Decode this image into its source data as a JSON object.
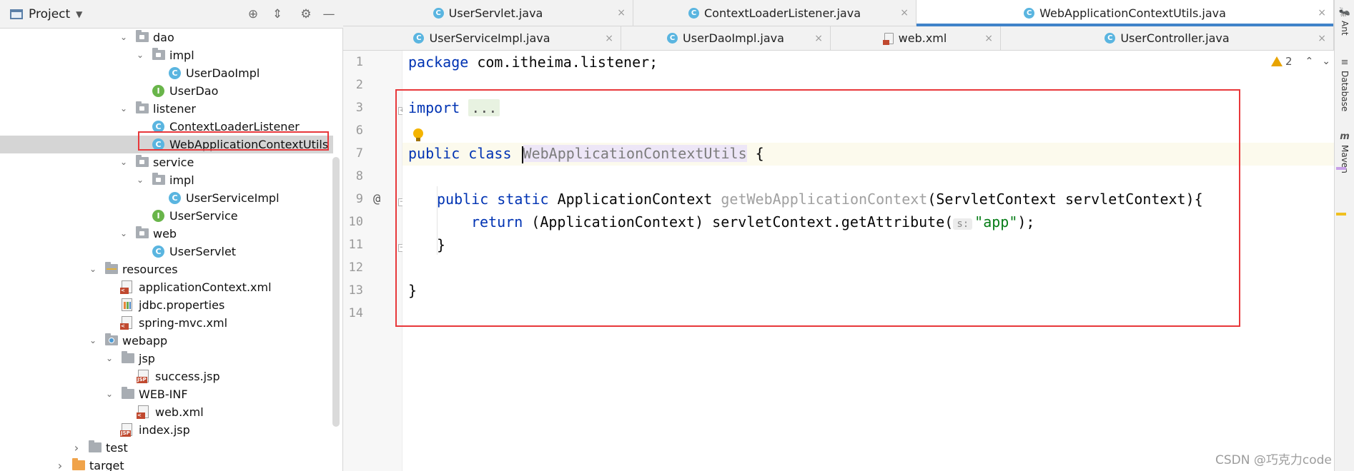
{
  "project_panel": {
    "title": "Project",
    "caret": "▼",
    "buttons": {
      "locate": "⊕",
      "collapse": "⇕",
      "settings": "⚙",
      "hide": "—"
    },
    "tree": [
      {
        "label": "dao",
        "type": "package",
        "arrow": "open",
        "indent": 1
      },
      {
        "label": "impl",
        "type": "package",
        "arrow": "open",
        "indent": 2
      },
      {
        "label": "UserDaoImpl",
        "type": "class",
        "icon_text": "C",
        "indent": 3
      },
      {
        "label": "UserDao",
        "type": "interface",
        "icon_text": "I",
        "indent": 2
      },
      {
        "label": "listener",
        "type": "package",
        "arrow": "open",
        "indent": 1
      },
      {
        "label": "ContextLoaderListener",
        "type": "class",
        "icon_text": "C",
        "indent": 2
      },
      {
        "label": "WebApplicationContextUtils",
        "type": "class",
        "icon_text": "C",
        "indent": 2,
        "selected": true
      },
      {
        "label": "service",
        "type": "package",
        "arrow": "open",
        "indent": 1
      },
      {
        "label": "impl",
        "type": "package",
        "arrow": "open",
        "indent": 2
      },
      {
        "label": "UserServiceImpl",
        "type": "class",
        "icon_text": "C",
        "indent": 3
      },
      {
        "label": "UserService",
        "type": "interface",
        "icon_text": "I",
        "indent": 2
      },
      {
        "label": "web",
        "type": "package",
        "arrow": "open",
        "indent": 1
      },
      {
        "label": "UserServlet",
        "type": "class",
        "icon_text": "C",
        "indent": 2
      },
      {
        "label": "resources",
        "type": "resources",
        "arrow": "open",
        "indent": 0
      },
      {
        "label": "applicationContext.xml",
        "type": "xml",
        "badge": "&lt;",
        "indent": 1
      },
      {
        "label": "jdbc.properties",
        "type": "properties",
        "indent": 1
      },
      {
        "label": "spring-mvc.xml",
        "type": "xml",
        "badge": "&lt;",
        "indent": 1
      },
      {
        "label": "webapp",
        "type": "webapp",
        "arrow": "open",
        "indent": 0
      },
      {
        "label": "jsp",
        "type": "folder",
        "arrow": "open",
        "indent": 1
      },
      {
        "label": "success.jsp",
        "type": "jsp",
        "badge": "JSP",
        "indent": 2
      },
      {
        "label": "WEB-INF",
        "type": "folder",
        "arrow": "open",
        "indent": 1
      },
      {
        "label": "web.xml",
        "type": "xml",
        "badge": "&lt;",
        "indent": 2
      },
      {
        "label": "index.jsp",
        "type": "jsp",
        "badge": "JSP",
        "indent": 1
      },
      {
        "label": "test",
        "type": "folder",
        "arrow": "closed",
        "indent": -1
      },
      {
        "label": "target",
        "type": "folder-orange",
        "arrow": "closed",
        "indent": -2
      }
    ]
  },
  "tabs": {
    "row1": [
      {
        "label": "UserServlet.java",
        "icon": "C",
        "close": "×"
      },
      {
        "label": "ContextLoaderListener.java",
        "icon": "C",
        "close": "×"
      },
      {
        "label": "WebApplicationContextUtils.java",
        "icon": "C",
        "close": "×",
        "active": true
      }
    ],
    "row2": [
      {
        "label": "UserServiceImpl.java",
        "icon": "C",
        "close": "×"
      },
      {
        "label": "UserDaoImpl.java",
        "icon": "C",
        "close": "×"
      },
      {
        "label": "web.xml",
        "icon": "xml",
        "close": "×"
      },
      {
        "label": "UserController.java",
        "icon": "C",
        "close": "×"
      }
    ]
  },
  "editor": {
    "line_numbers": [
      "1",
      "2",
      "3",
      "6",
      "7",
      "8",
      "9",
      "10",
      "11",
      "12",
      "13",
      "14"
    ],
    "gutter_at": "@",
    "warnings": {
      "count": "2",
      "up": "⌃",
      "down": "⌄"
    },
    "code": {
      "l1_kw": "package",
      "l1_rest": " com.itheima.listener;",
      "l3_kw": "import",
      "l3_fold": "...",
      "l7_kw": "public class ",
      "l7_cls": "WebApplicationContextUtils",
      "l7_rest": " {",
      "l9_kw": "public static ",
      "l9_type": "ApplicationContext ",
      "l9_method": "getWebApplicationContext",
      "l9_rest": "(ServletContext servletContext){",
      "l10_kw": "return ",
      "l10_rest": "(ApplicationContext) servletContext.getAttribute(",
      "l10_hint": "s:",
      "l10_str": "\"app\"",
      "l10_end": ");",
      "l11": "}",
      "l13": "}"
    }
  },
  "right_strip": [
    {
      "icon": "🐜",
      "label": "Ant"
    },
    {
      "icon": "≡",
      "label": "Database"
    },
    {
      "icon": "m",
      "label": "Maven"
    }
  ],
  "watermark": "CSDN @巧克力code",
  "colors": {
    "keyword": "#0033b3",
    "string": "#067d17",
    "highlight_box": "#e8383b",
    "active_tab": "#4083c9"
  }
}
